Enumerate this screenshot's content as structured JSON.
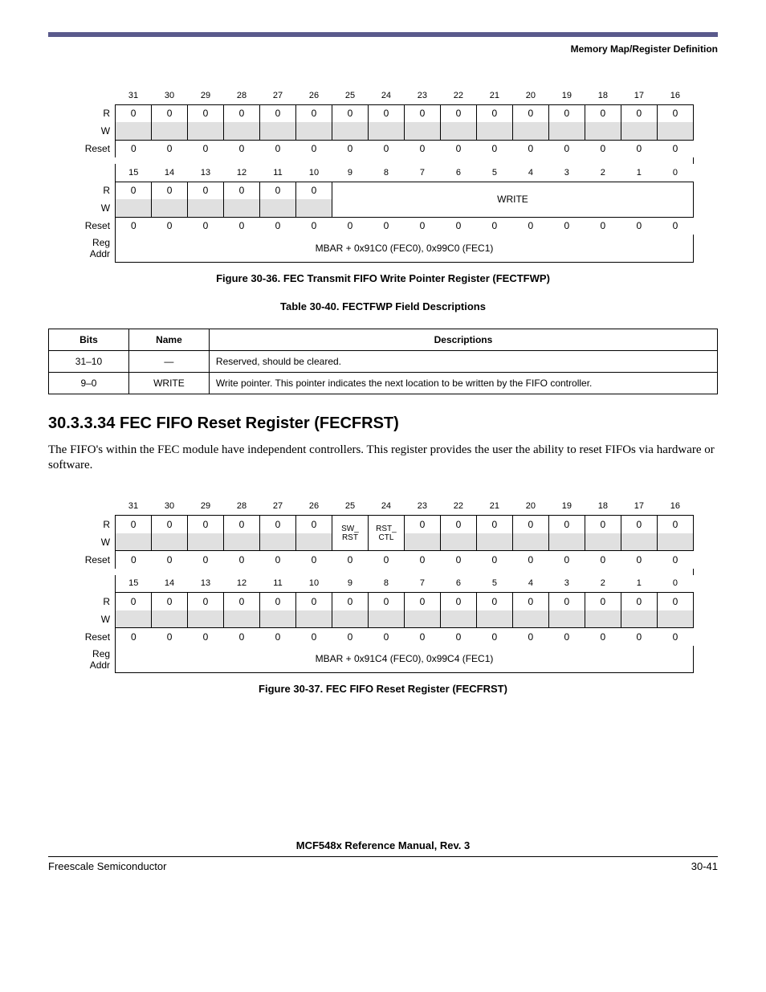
{
  "header": {
    "section_title": "Memory Map/Register Definition"
  },
  "reg1": {
    "bits_hi": [
      "31",
      "30",
      "29",
      "28",
      "27",
      "26",
      "25",
      "24",
      "23",
      "22",
      "21",
      "20",
      "19",
      "18",
      "17",
      "16"
    ],
    "bits_lo": [
      "15",
      "14",
      "13",
      "12",
      "11",
      "10",
      "9",
      "8",
      "7",
      "6",
      "5",
      "4",
      "3",
      "2",
      "1",
      "0"
    ],
    "r_hi": [
      "0",
      "0",
      "0",
      "0",
      "0",
      "0",
      "0",
      "0",
      "0",
      "0",
      "0",
      "0",
      "0",
      "0",
      "0",
      "0"
    ],
    "r_lo6": [
      "0",
      "0",
      "0",
      "0",
      "0",
      "0"
    ],
    "span_label": "WRITE",
    "reset_hi": [
      "0",
      "0",
      "0",
      "0",
      "0",
      "0",
      "0",
      "0",
      "0",
      "0",
      "0",
      "0",
      "0",
      "0",
      "0",
      "0"
    ],
    "reset_lo": [
      "0",
      "0",
      "0",
      "0",
      "0",
      "0",
      "0",
      "0",
      "0",
      "0",
      "0",
      "0",
      "0",
      "0",
      "0",
      "0"
    ],
    "labels": {
      "r": "R",
      "w": "W",
      "reset": "Reset",
      "addr": "Reg Addr"
    },
    "addr": "MBAR + 0x91C0 (FEC0), 0x99C0 (FEC1)",
    "caption": "Figure 30-36.  FEC Transmit FIFO Write Pointer Register (FECTFWP)"
  },
  "table1": {
    "caption": "Table 30-40. FECTFWP Field Descriptions",
    "headers": {
      "bits": "Bits",
      "name": "Name",
      "desc": "Descriptions"
    },
    "rows": [
      {
        "bits": "31–10",
        "name": "—",
        "desc": "Reserved, should be cleared."
      },
      {
        "bits": "9–0",
        "name": "WRITE",
        "desc": "Write pointer. This pointer indicates the next location to be written by the FIFO controller."
      }
    ]
  },
  "section": {
    "number": "30.3.3.34",
    "title": "FEC FIFO Reset Register (FECFRST)",
    "body": "The FIFO's within the FEC module have independent controllers. This register provides the user the ability to reset FIFOs via hardware or software."
  },
  "reg2": {
    "bits_hi": [
      "31",
      "30",
      "29",
      "28",
      "27",
      "26",
      "25",
      "24",
      "23",
      "22",
      "21",
      "20",
      "19",
      "18",
      "17",
      "16"
    ],
    "bits_lo": [
      "15",
      "14",
      "13",
      "12",
      "11",
      "10",
      "9",
      "8",
      "7",
      "6",
      "5",
      "4",
      "3",
      "2",
      "1",
      "0"
    ],
    "r_hi_left6": [
      "0",
      "0",
      "0",
      "0",
      "0",
      "0"
    ],
    "r_hi_span1": "SW_RST",
    "r_hi_span2": "RST_CTL",
    "r_hi_right8": [
      "0",
      "0",
      "0",
      "0",
      "0",
      "0",
      "0",
      "0"
    ],
    "r_lo": [
      "0",
      "0",
      "0",
      "0",
      "0",
      "0",
      "0",
      "0",
      "0",
      "0",
      "0",
      "0",
      "0",
      "0",
      "0",
      "0"
    ],
    "reset_hi": [
      "0",
      "0",
      "0",
      "0",
      "0",
      "0",
      "0",
      "0",
      "0",
      "0",
      "0",
      "0",
      "0",
      "0",
      "0",
      "0"
    ],
    "reset_lo": [
      "0",
      "0",
      "0",
      "0",
      "0",
      "0",
      "0",
      "0",
      "0",
      "0",
      "0",
      "0",
      "0",
      "0",
      "0",
      "0"
    ],
    "labels": {
      "r": "R",
      "w": "W",
      "reset": "Reset",
      "addr": "Reg Addr"
    },
    "addr": "MBAR + 0x91C4 (FEC0), 0x99C4 (FEC1)",
    "caption": "Figure 30-37. FEC FIFO Reset Register (FECFRST)"
  },
  "footer": {
    "doc": "MCF548x Reference Manual, Rev. 3",
    "left": "Freescale Semiconductor",
    "right": "30-41"
  }
}
